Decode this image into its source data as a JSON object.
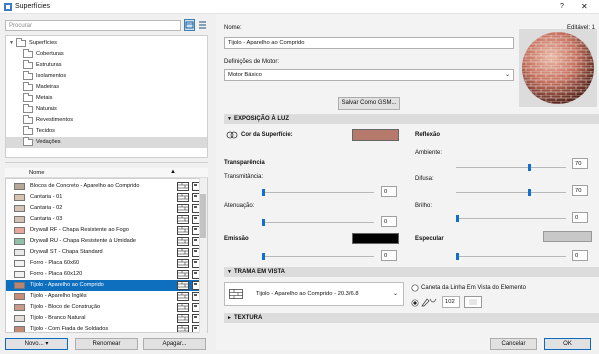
{
  "window": {
    "title": "Superfícies",
    "help": "?",
    "close": "✕"
  },
  "search": {
    "placeholder": "Procurar"
  },
  "tree": {
    "root": "Superfícies",
    "folders": [
      "Coberturas",
      "Estruturas",
      "Isolamentos",
      "Madeiras",
      "Metais",
      "Naturais",
      "Revestimentos",
      "Tecidos",
      "Vedações"
    ],
    "selected_folder": "Vedações"
  },
  "list": {
    "header": "Nome",
    "items": [
      {
        "name": "Blocos de Concreto - Aparelho ao Comprido",
        "color": "#b7a99a"
      },
      {
        "name": "Cantaria - 01",
        "color": "#d8c2b0"
      },
      {
        "name": "Cantaria - 02",
        "color": "#d6c3b4"
      },
      {
        "name": "Cantaria - 03",
        "color": "#d2c0b2"
      },
      {
        "name": "Drywall RF - Chapa Resistente ao Fogo",
        "color": "#e8a79a"
      },
      {
        "name": "Drywall RU - Chapa Resistente à Umidade",
        "color": "#8ec1a5"
      },
      {
        "name": "Drywall ST - Chapa Standard",
        "color": "#e9e9e9"
      },
      {
        "name": "Forro - Placa 60x60",
        "color": "#f2f2f2"
      },
      {
        "name": "Forro - Placa 60x120",
        "color": "#f2f2f2"
      },
      {
        "name": "Tijolo - Aparelho ao Comprido",
        "color": "#b98572"
      },
      {
        "name": "Tijolo - Aparelho Inglês",
        "color": "#c58d77"
      },
      {
        "name": "Tijolo - Bloco de Construção",
        "color": "#c99a86"
      },
      {
        "name": "Tijolo - Branco Natural",
        "color": "#e4dedb"
      },
      {
        "name": "Tijolo - Com Fiada de Soldados",
        "color": "#c48a76"
      }
    ],
    "selected_index": 9
  },
  "buttons": {
    "new": "Novo...",
    "rename": "Renomear",
    "delete": "Apagar...",
    "cancel": "Cancelar",
    "ok": "OK"
  },
  "detail": {
    "name_label": "Nome:",
    "editable": "Editável: 1",
    "name_value": "Tijolo - Aparelho ao Comprido",
    "engine_label": "Definições de Motor:",
    "engine_value": "Motor Básico",
    "save_gsm": "Salvar Como GSM..."
  },
  "exposure": {
    "title": "EXPOSIÇÃO À LUZ",
    "surface_color_label": "Cor da Superfície:",
    "surface_color": "#b57a6c",
    "transparency": "Transparência",
    "transmittance": "Transmitância:",
    "transmittance_value": "0",
    "attenuation": "Atenuação:",
    "attenuation_value": "0",
    "emission": "Emissão",
    "emission_value": "0",
    "emission_color": "#000000",
    "reflection": "Reflexão",
    "ambient": "Ambiente:",
    "ambient_value": "70",
    "diffuse": "Difusa:",
    "diffuse_value": "70",
    "brightness": "Brilho:",
    "brightness_value": "0",
    "specular": "Especular",
    "specular_value": "0",
    "specular_color": "#c8c8c8"
  },
  "hatch": {
    "title": "TRAMA EM VISTA",
    "hatch_name": "Tijolo - Aparelho ao Comprido - 20.3/6.8",
    "option_pen": "Caneta da Linha Em Vista do Elemento",
    "pen_number": "102"
  },
  "texture": {
    "title": "TEXTURA"
  }
}
